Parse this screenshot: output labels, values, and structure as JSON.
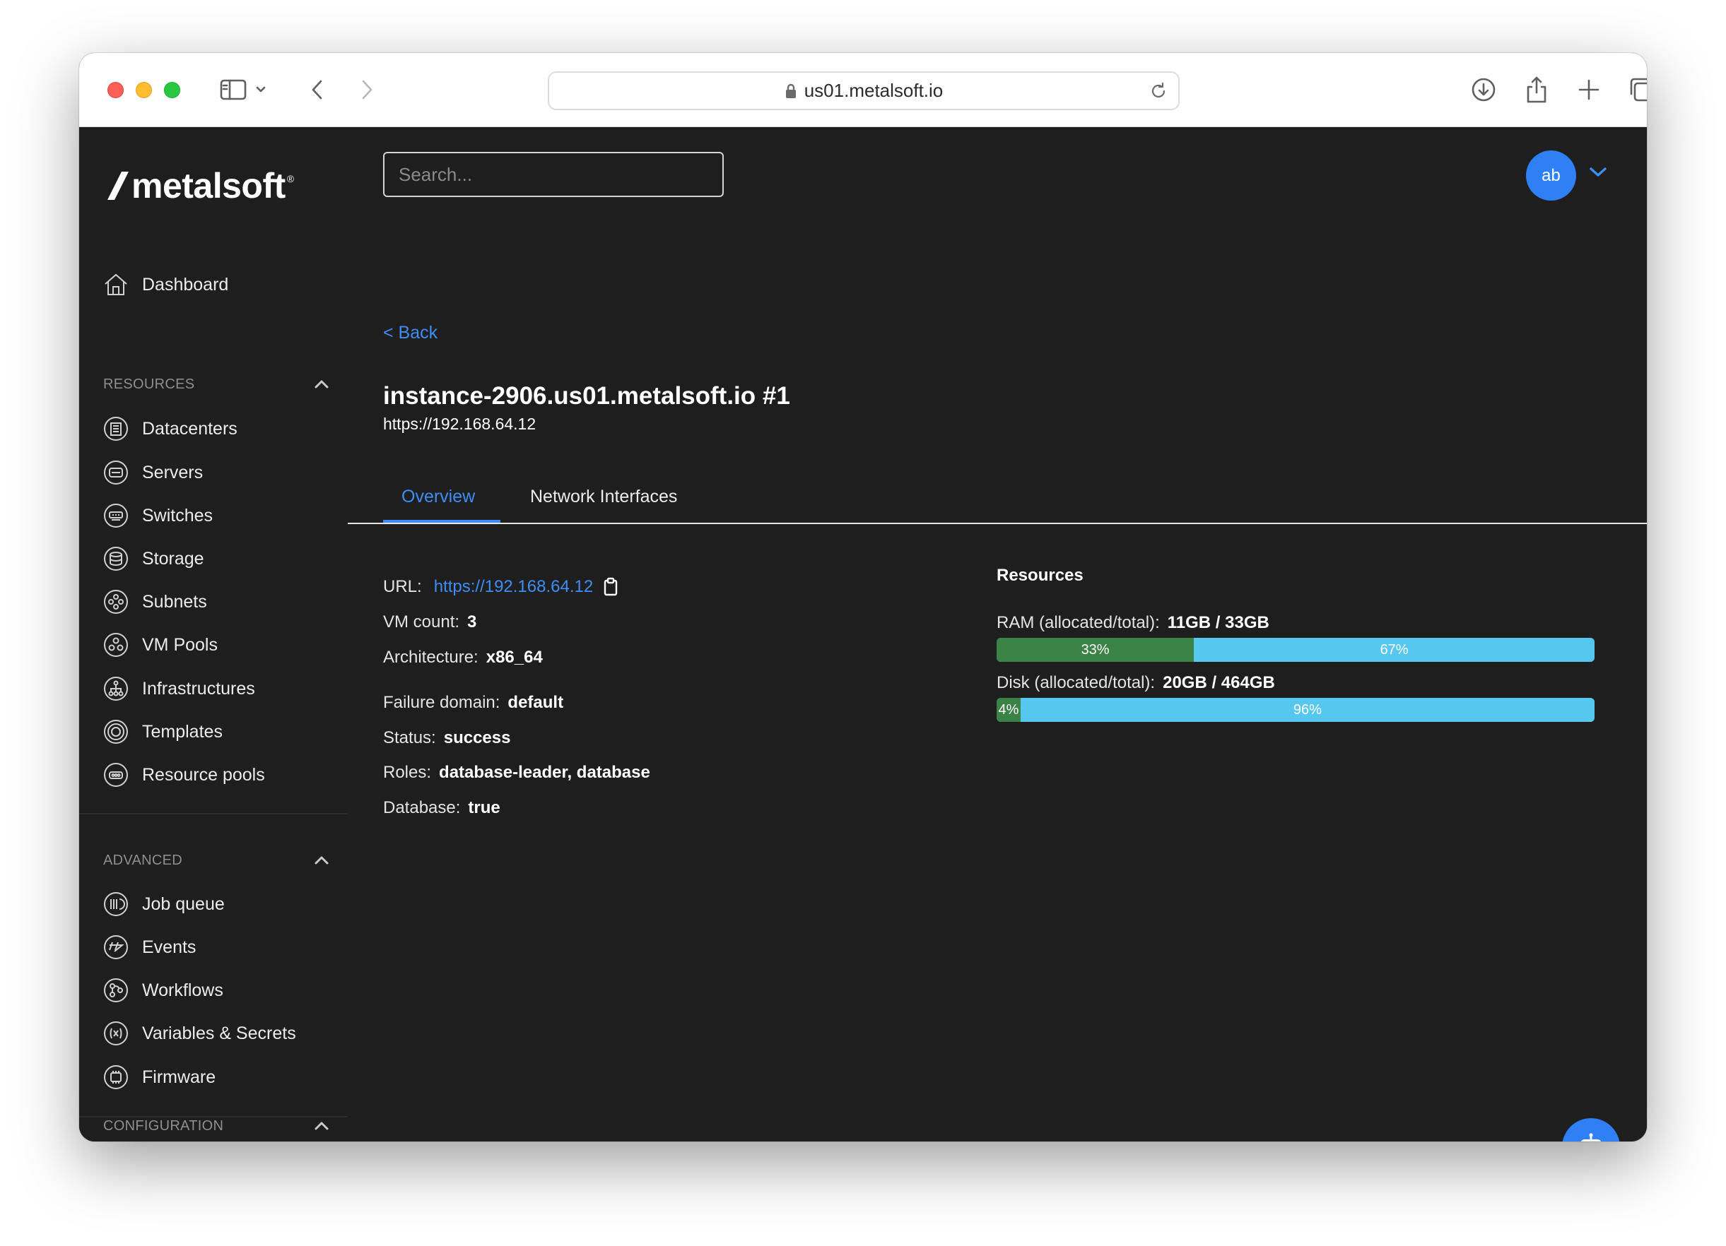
{
  "browser": {
    "url": "us01.metalsoft.io"
  },
  "brand": {
    "name": "metalsoft",
    "reg": "®"
  },
  "sidebar": {
    "dashboard": "Dashboard",
    "resources_title": "RESOURCES",
    "resources": [
      "Datacenters",
      "Servers",
      "Switches",
      "Storage",
      "Subnets",
      "VM Pools",
      "Infrastructures",
      "Templates",
      "Resource pools"
    ],
    "advanced_title": "ADVANCED",
    "advanced": [
      "Job queue",
      "Events",
      "Workflows",
      "Variables & Secrets",
      "Firmware"
    ],
    "configuration_title": "CONFIGURATION"
  },
  "header": {
    "search_placeholder": "Search...",
    "avatar_initials": "ab"
  },
  "page": {
    "back_label": "< Back",
    "title": "instance-2906.us01.metalsoft.io #1",
    "subtitle": "https://192.168.64.12",
    "tabs": [
      "Overview",
      "Network Interfaces"
    ],
    "active_tab": "Overview"
  },
  "overview": {
    "url_label": "URL:",
    "url_value": "https://192.168.64.12",
    "vm_count_label": "VM count:",
    "vm_count_value": "3",
    "architecture_label": "Architecture:",
    "architecture_value": "x86_64",
    "failure_domain_label": "Failure domain:",
    "failure_domain_value": "default",
    "status_label": "Status:",
    "status_value": "success",
    "roles_label": "Roles:",
    "roles_value": "database-leader, database",
    "database_label": "Database:",
    "database_value": "true"
  },
  "resources": {
    "title": "Resources",
    "ram_label": "RAM (allocated/total):",
    "ram_value": "11GB / 33GB",
    "ram_used_pct": 33,
    "ram_used_text": "33%",
    "ram_free_text": "67%",
    "disk_label": "Disk (allocated/total):",
    "disk_value": "20GB / 464GB",
    "disk_used_pct": 4,
    "disk_used_text": "4%",
    "disk_free_text": "96%"
  },
  "colors": {
    "accent": "#3d8df5",
    "background": "#1e1e1e",
    "used_bar": "#3b8246",
    "free_bar": "#56c8ef",
    "avatar": "#2f80f5"
  },
  "icons": {
    "sidebar_toggle": "sidebar-icon",
    "downloads": "download-icon",
    "share": "share-icon",
    "new_tab": "plus-icon",
    "tab_overview": "tabs-icon",
    "assistant": "robot-icon"
  }
}
